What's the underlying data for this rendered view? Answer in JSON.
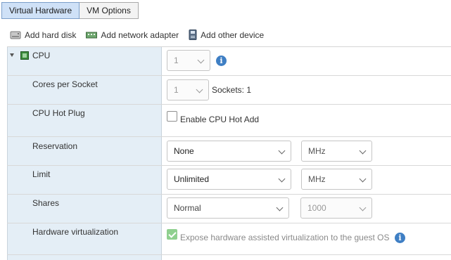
{
  "tabs": [
    {
      "label": "Virtual Hardware",
      "active": true
    },
    {
      "label": "VM Options",
      "active": false
    }
  ],
  "toolbar": {
    "add_hard_disk": "Add hard disk",
    "add_network_adapter": "Add network adapter",
    "add_other_device": "Add other device"
  },
  "cpu": {
    "label": "CPU",
    "count_value": "1",
    "cores_label": "Cores per Socket",
    "cores_value": "1",
    "sockets_text": "Sockets: 1",
    "hotplug_label": "CPU Hot Plug",
    "hotplug_checkbox_label": "Enable CPU Hot Add",
    "hotplug_checked": false,
    "reservation_label": "Reservation",
    "reservation_value": "None",
    "reservation_unit": "MHz",
    "limit_label": "Limit",
    "limit_value": "Unlimited",
    "limit_unit": "MHz",
    "shares_label": "Shares",
    "shares_value": "Normal",
    "shares_number": "1000",
    "hwvirt_label": "Hardware virtualization",
    "hwvirt_checkbox_label": "Expose hardware assisted virtualization to the guest OS",
    "hwvirt_checked": true
  },
  "colors": {
    "active_tab": "#cfe1f7",
    "label_column": "#e4eef6",
    "info_icon": "#3f7fc4",
    "checked_box": "#8fd08f"
  }
}
